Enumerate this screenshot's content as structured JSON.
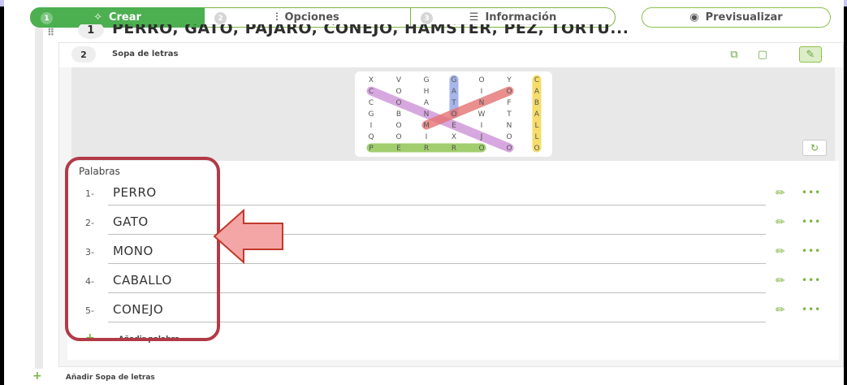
{
  "tabs": [
    {
      "num": "1",
      "label": "Crear",
      "icon": "magic-wand-icon"
    },
    {
      "num": "2",
      "label": "Opciones",
      "icon": "sliders-icon"
    },
    {
      "num": "3",
      "label": "Información",
      "icon": "list-icon"
    },
    {
      "num": "",
      "label": "Previsualizar",
      "icon": "eye-icon"
    }
  ],
  "item1": {
    "num": "1",
    "title": "PERRO, GATO, PÁJARO, CONEJO, HÁMSTER, PEZ, TORTU..."
  },
  "item2": {
    "num": "2",
    "title": "Sopa de letras"
  },
  "wordsearch": {
    "letters": [
      [
        "X",
        "V",
        "G",
        "G",
        "O",
        "Y",
        "C"
      ],
      [
        "C",
        "O",
        "H",
        "A",
        "I",
        "O",
        "A"
      ],
      [
        "C",
        "O",
        "A",
        "T",
        "N",
        "F",
        "B"
      ],
      [
        "G",
        "B",
        "N",
        "O",
        "W",
        "T",
        "A"
      ],
      [
        "I",
        "O",
        "M",
        "E",
        "I",
        "N",
        "L"
      ],
      [
        "Q",
        "O",
        "I",
        "X",
        "J",
        "O",
        "L"
      ],
      [
        "P",
        "E",
        "R",
        "R",
        "O",
        "O",
        "O"
      ]
    ]
  },
  "words_section": {
    "title": "Palabras",
    "items": [
      {
        "num": "1-",
        "word": "PERRO"
      },
      {
        "num": "2-",
        "word": "GATO"
      },
      {
        "num": "3-",
        "word": "MONO"
      },
      {
        "num": "4-",
        "word": "CABALLO"
      },
      {
        "num": "5-",
        "word": "CONEJO"
      }
    ],
    "add_label": "Añadir palabra"
  },
  "add_sopa_label": "Añadir Sopa de letras",
  "colors": {
    "accent": "#4caf50",
    "highlight_border": "#b23a48",
    "arrow_fill": "#f4a6a6",
    "word_perro": "#8bc34a",
    "word_gato": "#90a4e8",
    "word_mono": "#e57373",
    "word_caballo": "#f5d547",
    "word_conejo": "#ce93d8"
  }
}
